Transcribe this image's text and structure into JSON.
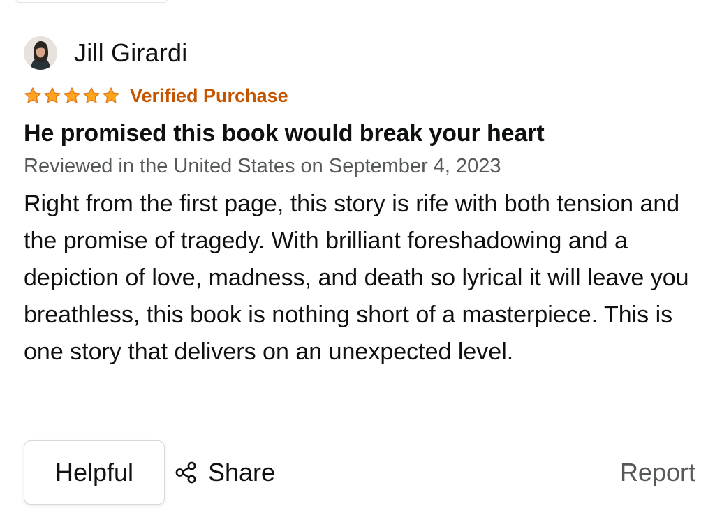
{
  "review": {
    "reviewer_name": "Jill Girardi",
    "rating": 5,
    "rating_max": 5,
    "verified_label": "Verified Purchase",
    "title": "He promised this book would break your heart",
    "date_text": "Reviewed in the United States on September 4, 2023",
    "body": "Right from the first page, this story is rife with both tension and the promise of tragedy. With brilliant foreshadowing and a depiction of love, madness, and death so lyrical it will leave you breathless, this book is nothing short of a masterpiece. This is one story that delivers on an unexpected level."
  },
  "actions": {
    "helpful_label": "Helpful",
    "share_label": "Share",
    "report_label": "Report"
  },
  "colors": {
    "star": "#ffa41c",
    "star_outline": "#de7921",
    "verified": "#c45500",
    "secondary_text": "#565959",
    "primary_text": "#0f1111"
  },
  "icons": {
    "avatar": "user-avatar",
    "share": "share-icon",
    "star": "star-icon"
  }
}
